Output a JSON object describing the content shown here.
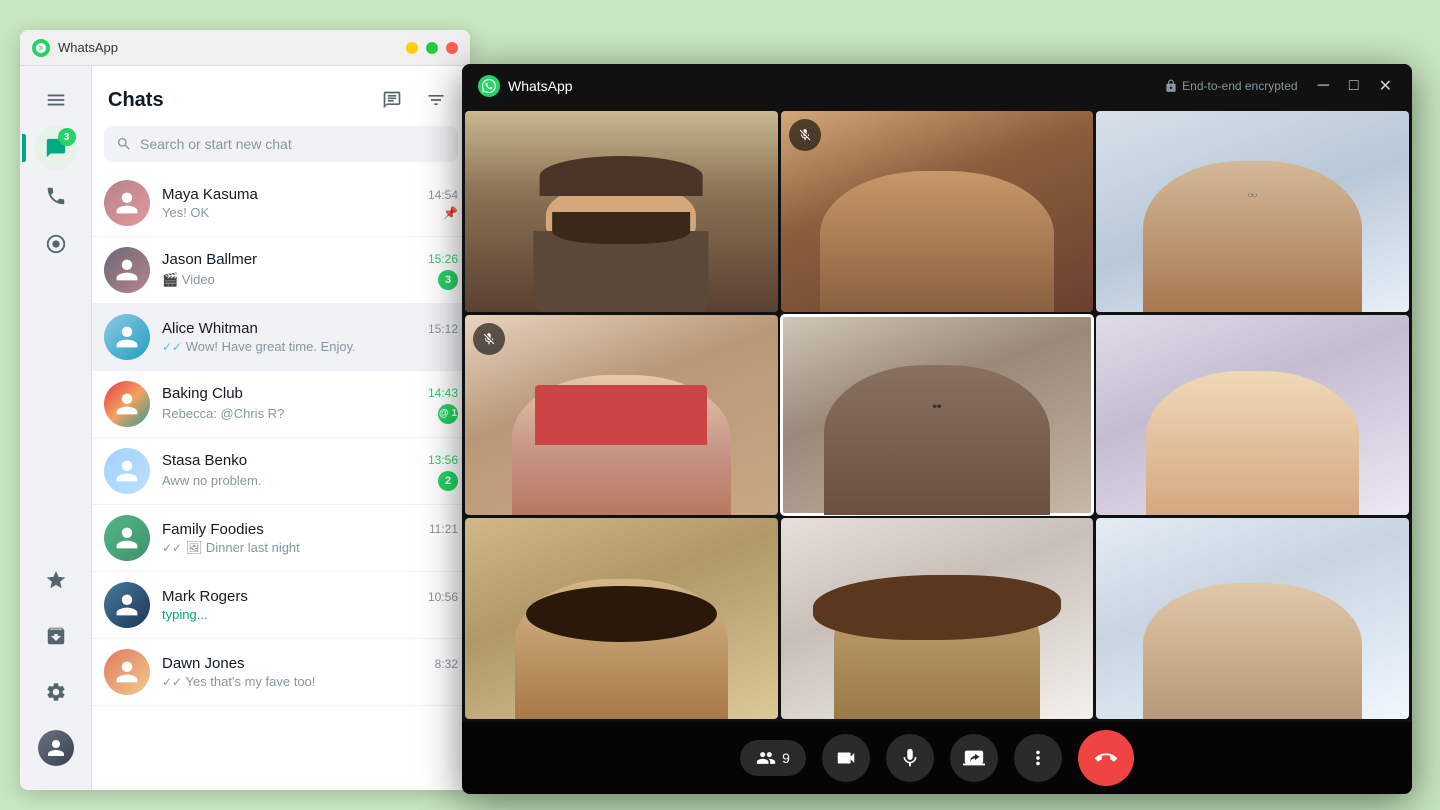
{
  "app": {
    "title": "WhatsApp",
    "encryption_label": "End-to-end encrypted"
  },
  "bg_window": {
    "title": "WhatsApp"
  },
  "sidebar": {
    "chat_badge": "3",
    "items": [
      {
        "name": "menu",
        "icon": "menu",
        "active": false
      },
      {
        "name": "chats",
        "icon": "chat",
        "active": true,
        "badge": "3"
      },
      {
        "name": "calls",
        "icon": "phone",
        "active": false
      },
      {
        "name": "status",
        "icon": "circle",
        "active": false
      },
      {
        "name": "starred",
        "icon": "star",
        "active": false
      },
      {
        "name": "archived",
        "icon": "archive",
        "active": false
      },
      {
        "name": "settings",
        "icon": "gear",
        "active": false
      }
    ]
  },
  "chats": {
    "title": "Chats",
    "search_placeholder": "Search or start new chat",
    "new_chat_label": "New chat",
    "filter_label": "Filter",
    "items": [
      {
        "name": "Maya Kasuma",
        "preview": "Yes! OK",
        "time": "14:54",
        "unread": 0,
        "pinned": true,
        "ticks": "double_grey",
        "avatar_class": "av-maya"
      },
      {
        "name": "Jason Ballmer",
        "preview": "🎬 Video",
        "time": "15:26",
        "unread": 3,
        "unread_time_color": "green",
        "avatar_class": "av-jason"
      },
      {
        "name": "Alice Whitman",
        "preview": "Wow! Have great time. Enjoy.",
        "time": "15:12",
        "unread": 0,
        "ticks": "double_blue",
        "active": true,
        "avatar_class": "av-alice"
      },
      {
        "name": "Baking Club",
        "preview": "Rebecca: @Chris R?",
        "time": "14:43",
        "unread": 1,
        "mention": true,
        "avatar_class": "av-baking"
      },
      {
        "name": "Stasa Benko",
        "preview": "Aww no problem.",
        "time": "13:56",
        "unread": 2,
        "avatar_class": "av-stasa"
      },
      {
        "name": "Family Foodies",
        "preview": "Dinner last night",
        "time": "11:21",
        "unread": 0,
        "ticks": "double_grey",
        "media": true,
        "avatar_class": "av-family"
      },
      {
        "name": "Mark Rogers",
        "preview": "typing...",
        "time": "10:56",
        "unread": 0,
        "typing": true,
        "avatar_class": "av-mark"
      },
      {
        "name": "Dawn Jones",
        "preview": "Yes that's my fave too!",
        "time": "8:32",
        "unread": 0,
        "ticks": "double_grey",
        "avatar_class": "av-dawn"
      }
    ]
  },
  "video_call": {
    "participants_count": "9",
    "controls": {
      "end_call_label": "End call",
      "mute_label": "Mute",
      "video_label": "Video",
      "share_label": "Share screen",
      "more_label": "More"
    },
    "grid": [
      {
        "id": 1,
        "mic_off": false,
        "highlighted": false
      },
      {
        "id": 2,
        "mic_off": true,
        "highlighted": false
      },
      {
        "id": 3,
        "mic_off": false,
        "highlighted": false
      },
      {
        "id": 4,
        "mic_off": true,
        "highlighted": false
      },
      {
        "id": 5,
        "mic_off": false,
        "highlighted": true
      },
      {
        "id": 6,
        "mic_off": false,
        "highlighted": false
      },
      {
        "id": 7,
        "mic_off": false,
        "highlighted": false
      },
      {
        "id": 8,
        "mic_off": false,
        "highlighted": false
      },
      {
        "id": 9,
        "mic_off": false,
        "highlighted": false
      }
    ]
  }
}
